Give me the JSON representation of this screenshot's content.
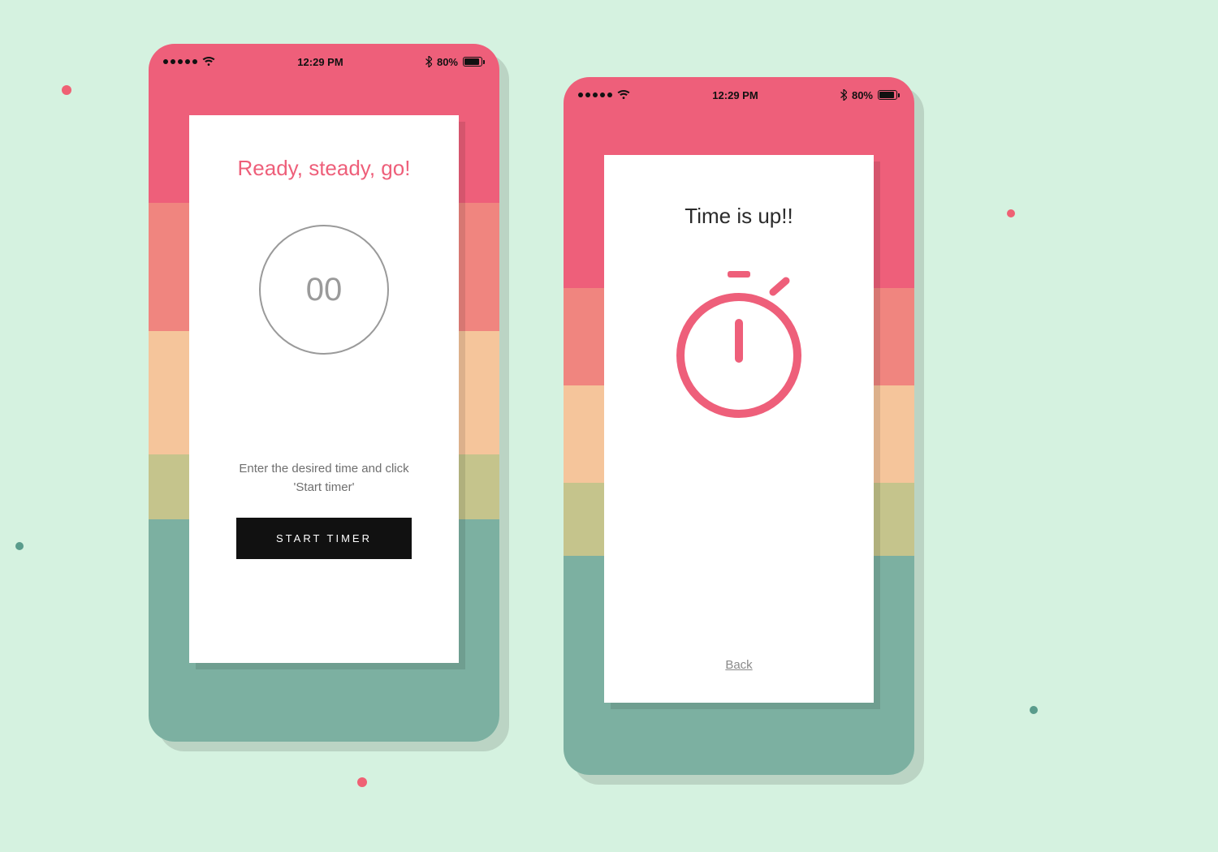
{
  "statusbar": {
    "time": "12:29 PM",
    "battery_pct": "80%"
  },
  "colors": {
    "accent_pink": "#ee5f7a",
    "accent_teal": "#7cb0a1",
    "bg_mint": "#d5f2e0"
  },
  "screen_left": {
    "title": "Ready, steady, go!",
    "timer_value": "00",
    "helper": "Enter the desired time and click 'Start timer'",
    "button_label": "START TIMER"
  },
  "screen_right": {
    "title": "Time is up!!",
    "back_label": "Back"
  }
}
